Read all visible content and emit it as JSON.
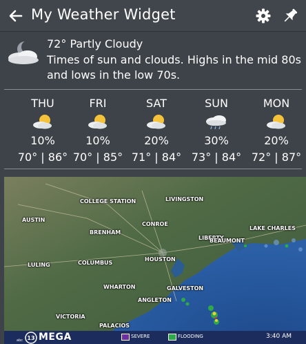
{
  "header": {
    "title": "My Weather Widget",
    "back_icon": "arrow-left-icon",
    "settings_icon": "gear-icon",
    "pin_icon": "pin-icon"
  },
  "current": {
    "summary": "72° Partly Cloudy",
    "description": "Times of sun and clouds. Highs in the mid 80s and lows in the low 70s.",
    "icon": "night-partly-cloudy-icon"
  },
  "forecast": [
    {
      "day": "THU",
      "precip": "10%",
      "range": "70° | 86°",
      "icon": "partly-sunny-icon"
    },
    {
      "day": "FRI",
      "precip": "10%",
      "range": "70° | 85°",
      "icon": "partly-sunny-icon"
    },
    {
      "day": "SAT",
      "precip": "20%",
      "range": "71° | 84°",
      "icon": "partly-sunny-icon"
    },
    {
      "day": "SUN",
      "precip": "30%",
      "range": "73° | 84°",
      "icon": "showers-icon"
    },
    {
      "day": "MON",
      "precip": "20%",
      "range": "72° | 87°",
      "icon": "partly-sunny-icon"
    }
  ],
  "map": {
    "cities": [
      "COLLEGE STATION",
      "LIVINGSTON",
      "AUSTIN",
      "CONROE",
      "LAKE CHARLES",
      "BRENHAM",
      "LIBERTY",
      "BEAUMONT",
      "LULING",
      "COLUMBUS",
      "HOUSTON",
      "WHARTON",
      "GALVESTON",
      "ANGLETON",
      "VICTORIA",
      "PALACIOS"
    ],
    "legend": {
      "brand": "MEGA",
      "severe": "SEVERE",
      "flooding": "FLOODING",
      "time": "3:40 AM"
    }
  },
  "colors": {
    "background": "#3e4349",
    "header": "#41464c",
    "divider": "#8a8f95",
    "map_legend": "#1c2c5c",
    "sun": "#f5c33b"
  }
}
